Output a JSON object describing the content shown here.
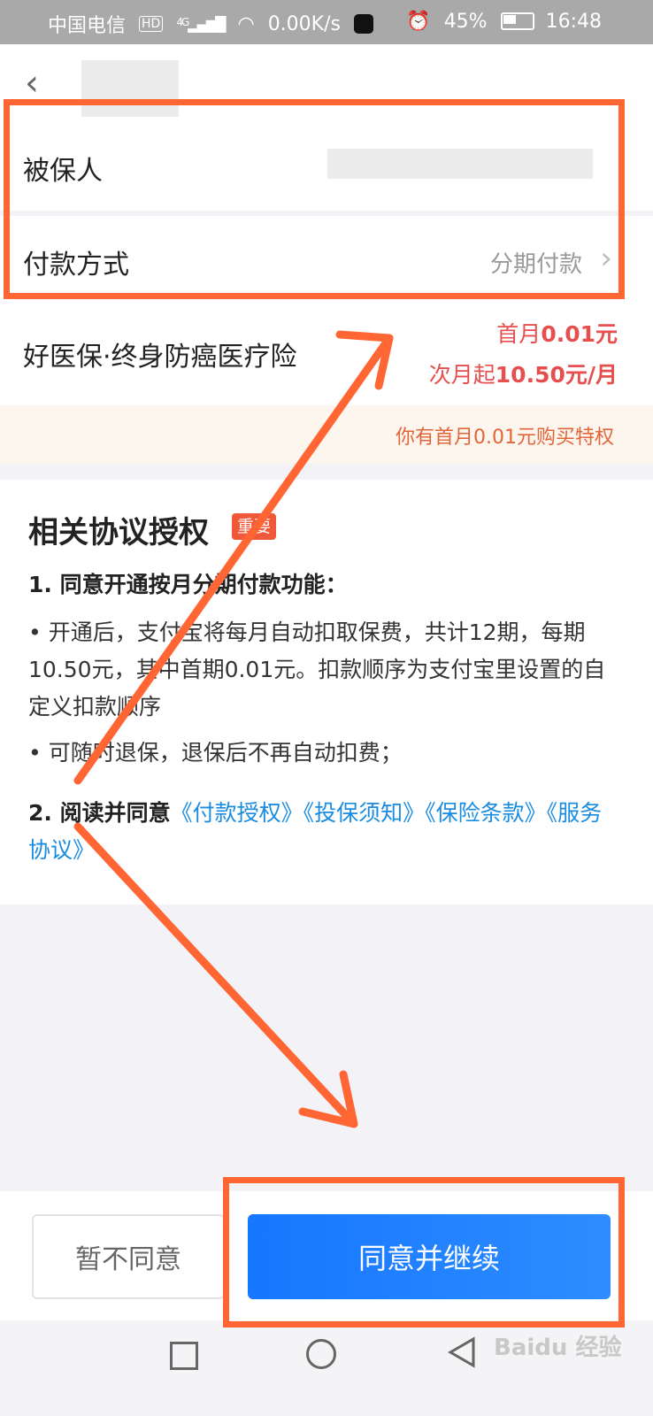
{
  "status_bar": {
    "carrier": "中国电信",
    "hd": "HD",
    "network": "4G",
    "speed": "0.00K/s",
    "battery": "45%",
    "time": "16:48"
  },
  "rows": {
    "insured_label": "被保人",
    "payment_label": "付款方式",
    "payment_value": "分期付款",
    "product_name": "好医保·终身防癌医疗险",
    "price_first_prefix": "首月",
    "price_first_amount": "0.01元",
    "price_next_prefix": "次月起",
    "price_next_amount": "10.50元/月"
  },
  "banner": "你有首月0.01元购买特权",
  "agreement": {
    "title": "相关协议授权",
    "badge": "重要",
    "item1": "1. 同意开通按月分期付款功能：",
    "bullet1": "• 开通后，支付宝将每月自动扣取保费，共计12期，每期10.50元，其中首期0.01元。扣款顺序为支付宝里设置的自定义扣款顺序",
    "bullet2": "• 可随时退保，退保后不再自动扣费；",
    "item2_prefix": "2. 阅读并同意",
    "links": [
      "《付款授权》",
      "《投保须知》",
      "《保险条款》",
      "《服务协议》"
    ]
  },
  "buttons": {
    "decline": "暂不同意",
    "agree": "同意并继续"
  },
  "watermark": "Baidu 经验",
  "colors": {
    "accent_blue": "#1677ff",
    "price_red": "#e74f4f",
    "annotation_orange": "#ff6633",
    "link_blue": "#1a8ce0"
  }
}
